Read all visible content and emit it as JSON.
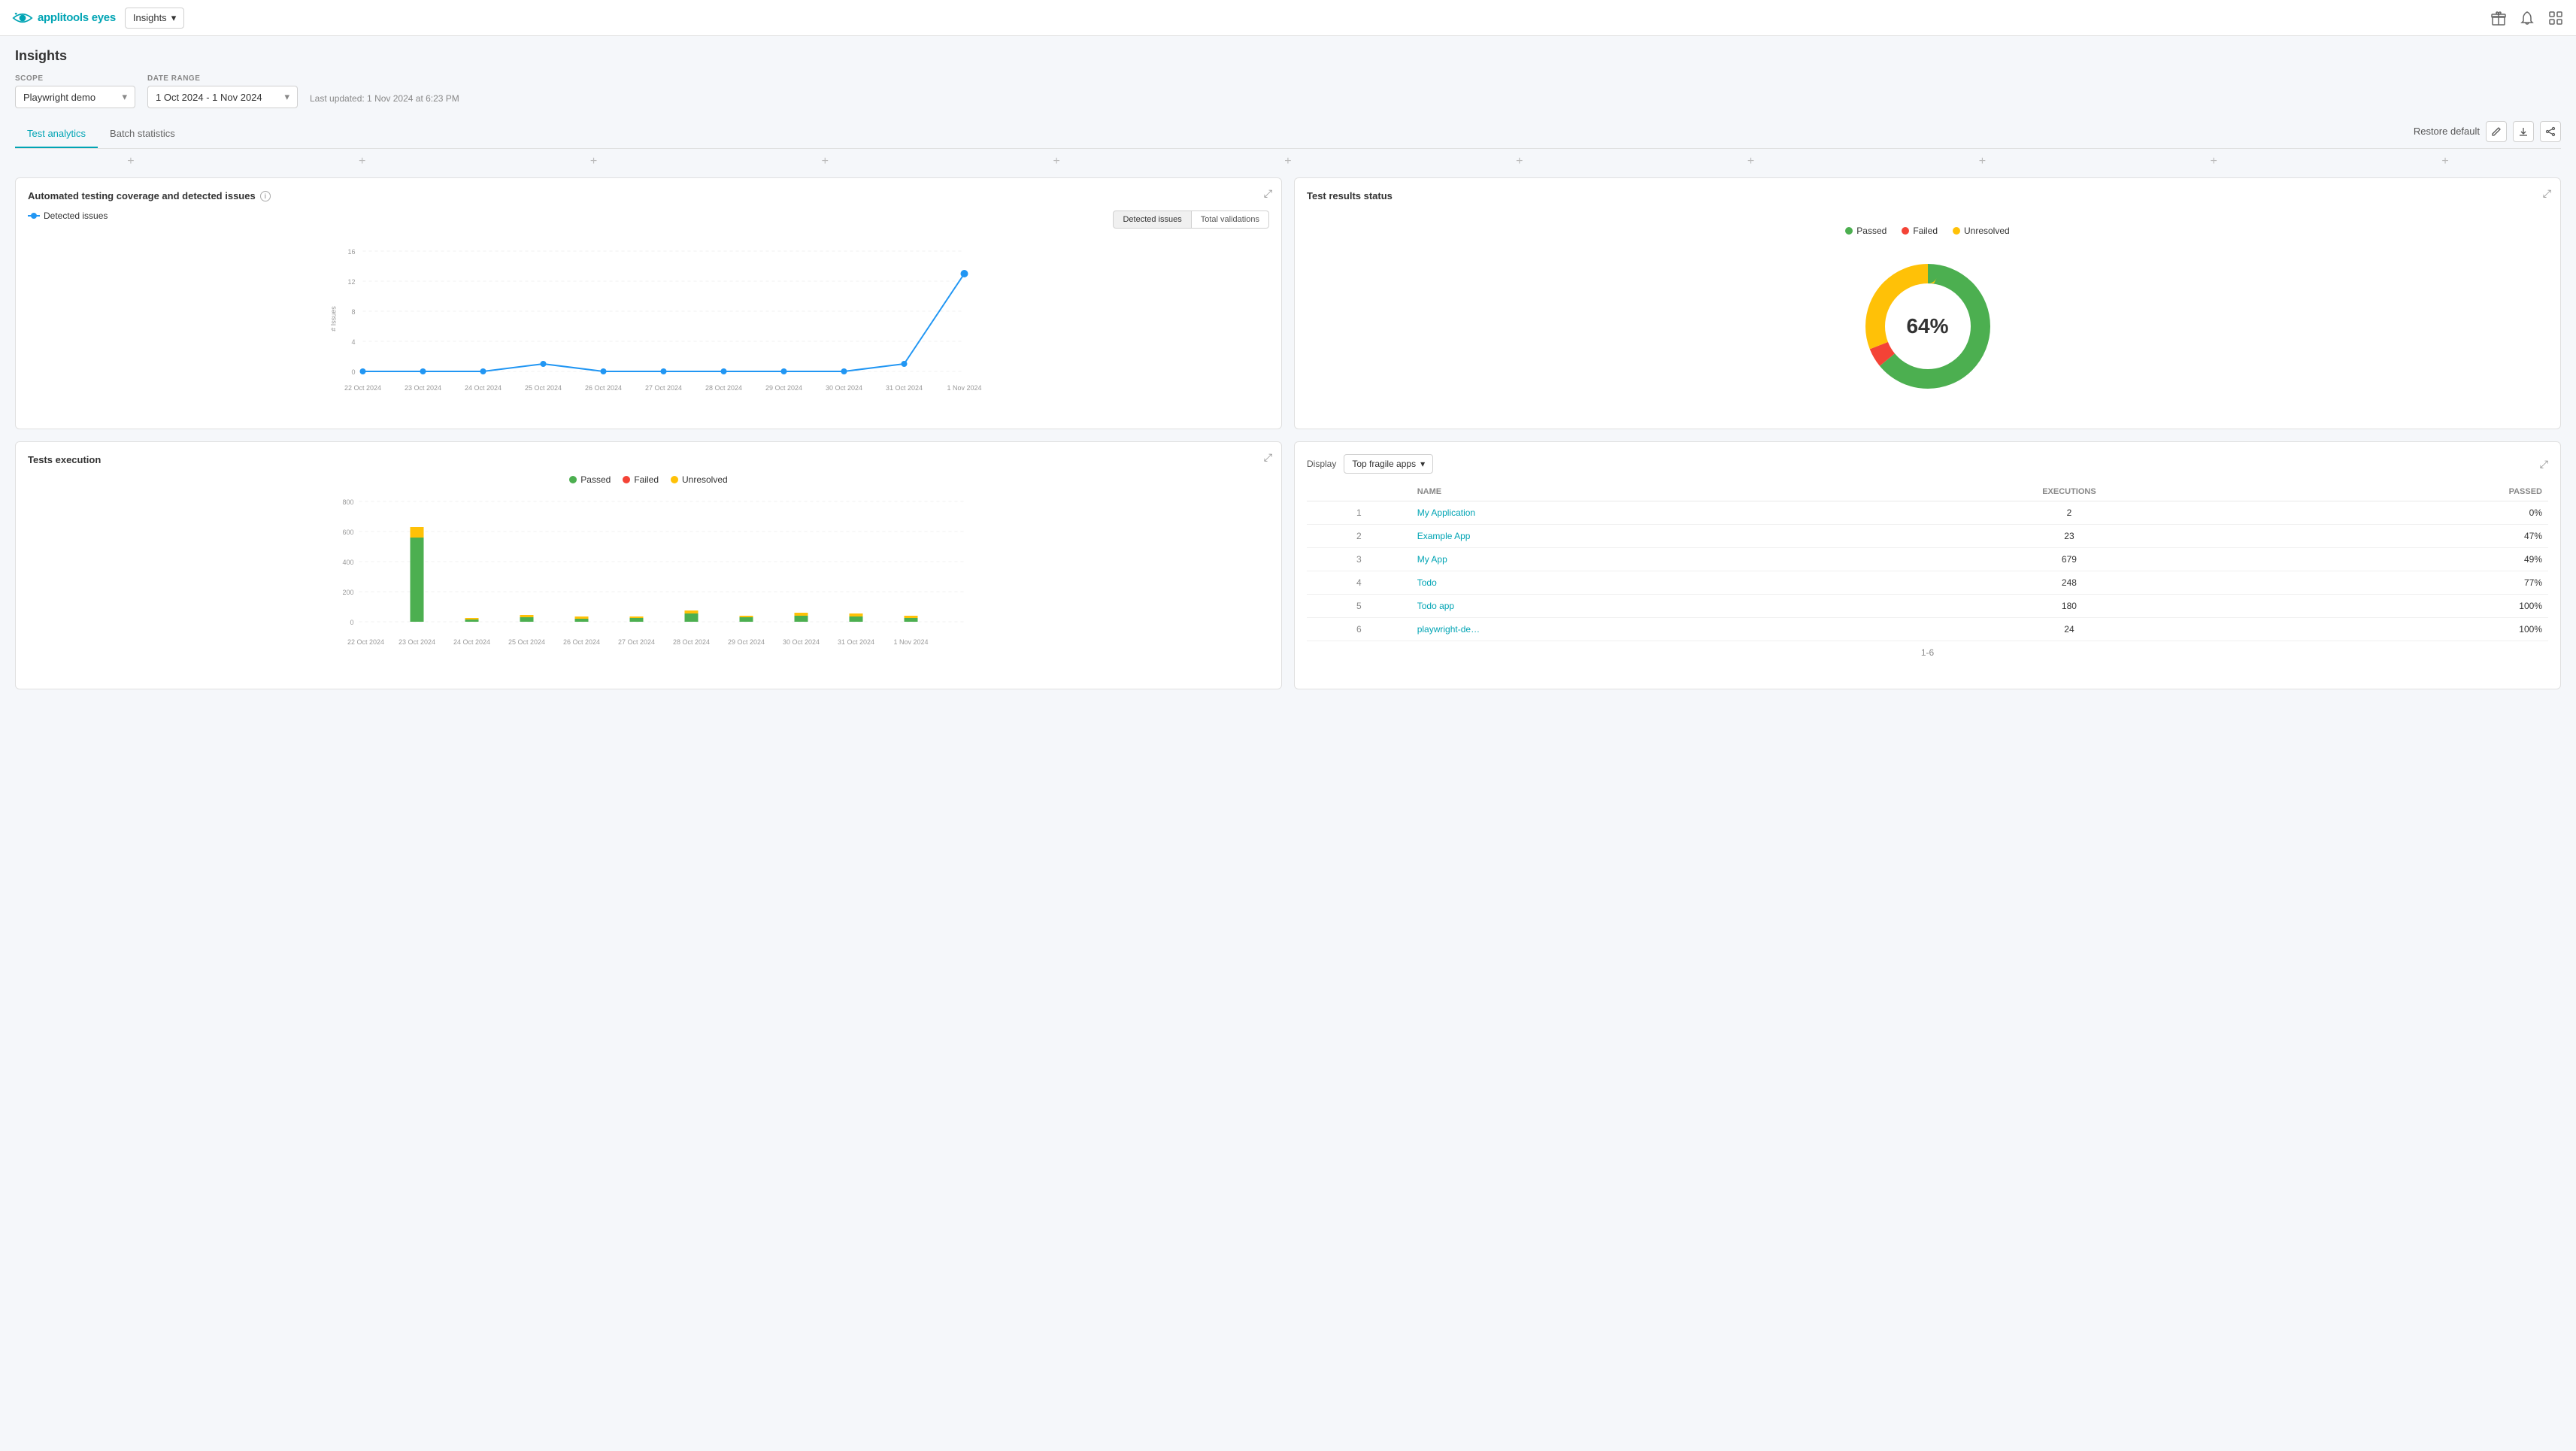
{
  "header": {
    "logo_text": "applitools eyes",
    "dropdown_label": "Insights",
    "icon1": "gift-icon",
    "icon2": "bell-icon",
    "icon3": "grid-icon"
  },
  "page": {
    "title": "Insights",
    "scope_label": "SCOPE",
    "scope_value": "Playwright demo",
    "date_range_label": "DATE RANGE",
    "date_range_value": "1 Oct 2024 - 1 Nov 2024",
    "last_updated": "Last updated: 1 Nov 2024 at 6:23 PM"
  },
  "tabs": [
    {
      "id": "test-analytics",
      "label": "Test analytics",
      "active": true
    },
    {
      "id": "batch-statistics",
      "label": "Batch statistics",
      "active": false
    }
  ],
  "restore_default": "Restore default",
  "coverage_chart": {
    "title": "Automated testing coverage and detected issues",
    "legend_detected": "Detected issues",
    "toggle_detected": "Detected issues",
    "toggle_total": "Total validations",
    "y_label": "# Issues",
    "x_dates": [
      "22 Oct 2024",
      "23 Oct 2024",
      "24 Oct 2024",
      "25 Oct 2024",
      "26 Oct 2024",
      "27 Oct 2024",
      "28 Oct 2024",
      "29 Oct 2024",
      "30 Oct 2024",
      "31 Oct 2024",
      "1 Nov 2024"
    ],
    "y_values": [
      0,
      4,
      8,
      12,
      16
    ],
    "data_points": [
      0,
      0,
      0,
      1,
      0,
      0,
      0,
      0,
      0,
      1,
      13
    ]
  },
  "test_results": {
    "title": "Test results status",
    "legend": [
      {
        "label": "Passed",
        "color": "#4caf50"
      },
      {
        "label": "Failed",
        "color": "#f44336"
      },
      {
        "label": "Unresolved",
        "color": "#ffc107"
      }
    ],
    "center_percent": "64%",
    "passed_pct": 64,
    "failed_pct": 5,
    "unresolved_pct": 31
  },
  "execution_chart": {
    "title": "Tests execution",
    "legend": [
      {
        "label": "Passed",
        "color": "#4caf50"
      },
      {
        "label": "Failed",
        "color": "#f44336"
      },
      {
        "label": "Unresolved",
        "color": "#ffc107"
      }
    ],
    "x_dates": [
      "22 Oct 2024",
      "23 Oct 2024",
      "24 Oct 2024",
      "25 Oct 2024",
      "26 Oct 2024",
      "27 Oct 2024",
      "28 Oct 2024",
      "29 Oct 2024",
      "30 Oct 2024",
      "31 Oct 2024",
      "1 Nov 2024"
    ],
    "y_values": [
      0,
      200,
      400,
      600,
      800
    ],
    "bars": [
      {
        "date": "22 Oct 2024",
        "passed": 0,
        "failed": 0,
        "unresolved": 0
      },
      {
        "date": "23 Oct 2024",
        "passed": 560,
        "failed": 0,
        "unresolved": 70
      },
      {
        "date": "24 Oct 2024",
        "passed": 5,
        "failed": 0,
        "unresolved": 3
      },
      {
        "date": "25 Oct 2024",
        "passed": 30,
        "failed": 0,
        "unresolved": 15
      },
      {
        "date": "26 Oct 2024",
        "passed": 20,
        "failed": 0,
        "unresolved": 18
      },
      {
        "date": "27 Oct 2024",
        "passed": 25,
        "failed": 0,
        "unresolved": 10
      },
      {
        "date": "28 Oct 2024",
        "passed": 55,
        "failed": 0,
        "unresolved": 20
      },
      {
        "date": "29 Oct 2024",
        "passed": 30,
        "failed": 0,
        "unresolved": 8
      },
      {
        "date": "30 Oct 2024",
        "passed": 40,
        "failed": 0,
        "unresolved": 20
      },
      {
        "date": "31 Oct 2024",
        "passed": 35,
        "failed": 0,
        "unresolved": 22
      },
      {
        "date": "1 Nov 2024",
        "passed": 25,
        "failed": 0,
        "unresolved": 18
      }
    ]
  },
  "fragile_apps": {
    "display_label": "Display",
    "display_value": "Top fragile apps",
    "columns": [
      "NAME",
      "EXECUTIONS",
      "PASSED"
    ],
    "rows": [
      {
        "num": 1,
        "name": "My Application",
        "link": true,
        "executions": 2,
        "passed": "0%"
      },
      {
        "num": 2,
        "name": "Example App",
        "link": true,
        "executions": 23,
        "passed": "47%"
      },
      {
        "num": 3,
        "name": "My App",
        "link": true,
        "executions": 679,
        "passed": "49%"
      },
      {
        "num": 4,
        "name": "Todo",
        "link": true,
        "executions": 248,
        "passed": "77%"
      },
      {
        "num": 5,
        "name": "Todo app",
        "link": true,
        "executions": 180,
        "passed": "100%"
      },
      {
        "num": 6,
        "name": "playwright-de…",
        "link": true,
        "executions": 24,
        "passed": "100%"
      }
    ],
    "pagination": "1-6"
  },
  "add_col_plus": "+",
  "col_dividers": [
    "+",
    "+",
    "+",
    "+",
    "+",
    "+",
    "+",
    "+",
    "+",
    "+"
  ]
}
